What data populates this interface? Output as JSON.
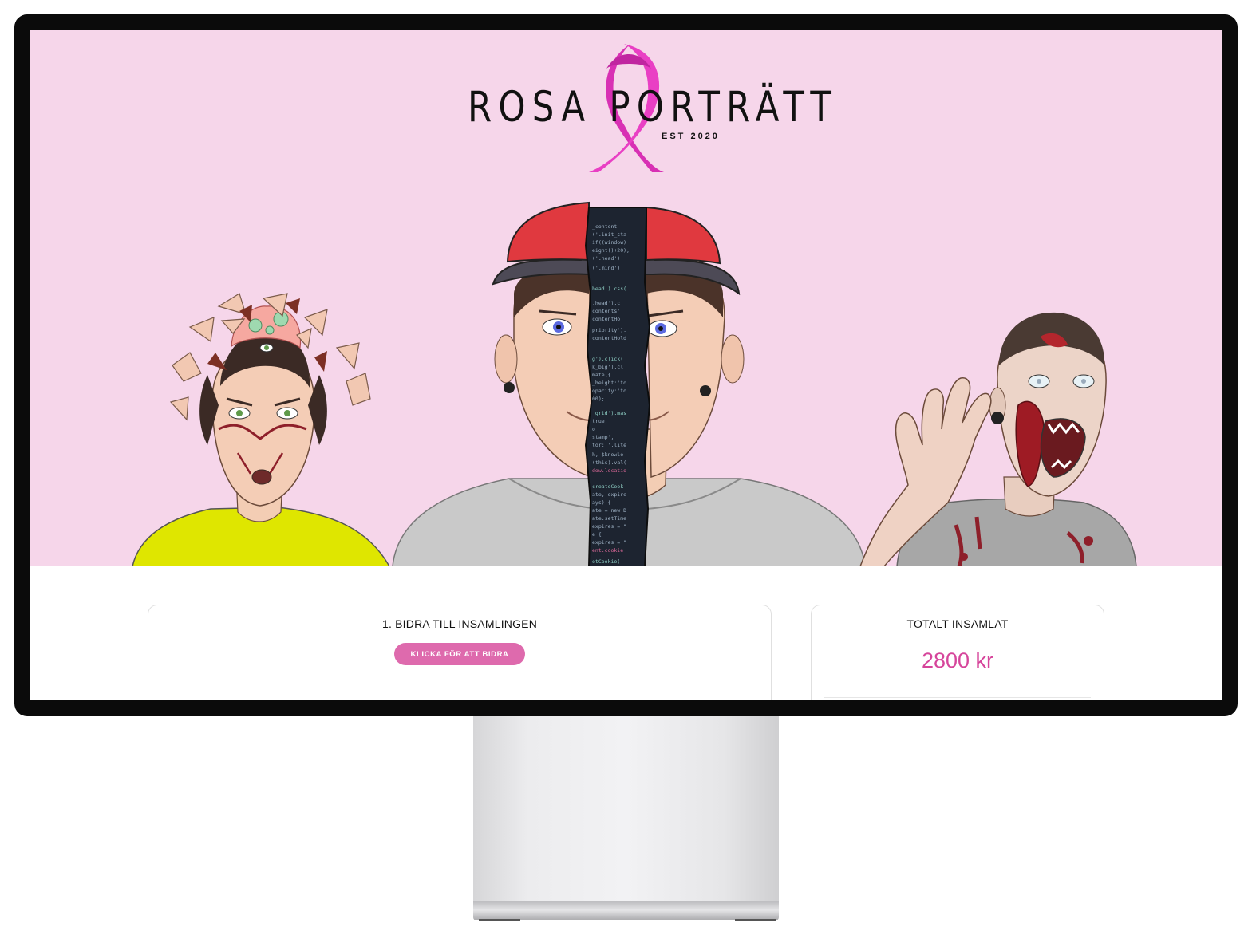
{
  "hero": {
    "brand_title": "ROSA PORTRÄTT",
    "brand_subtitle": "EST 2020",
    "code_lines": [
      "_content",
      "('.init_sta",
      "if((window)",
      "eight()+20);",
      "('.head')",
      "('.mind')",
      "head').css(",
      ".head').c",
      "contents'",
      "contentHo",
      "priority').",
      "contentHold",
      "g').click(",
      "k_big').cl",
      "mate({",
      "_height:'to",
      "opacity:'to",
      "00);",
      "_grid').mas",
      "true,",
      "o_",
      "stamp',",
      "tor: '.lite",
      "h, $knowle",
      "(this).val(",
      "dow.locatio",
      "createCook",
      "ate, expire",
      "ays) {",
      "ate = new D",
      "ate.setTime",
      "expires = \"",
      "e {",
      "expires = \"",
      "ent.cookie",
      "etCookie("
    ]
  },
  "donate_card": {
    "title": "1. BIDRA TILL INSAMLINGEN",
    "button_label": "KLICKA FÖR ATT BIDRA"
  },
  "total_card": {
    "title": "TOTALT INSAMLAT",
    "amount": "2800 kr"
  },
  "colors": {
    "hero_background": "#f6d6ea",
    "ribbon": "#e93fc4",
    "button": "#de6aad",
    "amount_text": "#d6459b"
  }
}
